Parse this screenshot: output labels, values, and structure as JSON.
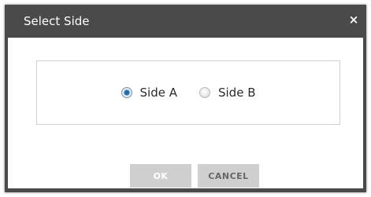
{
  "dialog": {
    "title": "Select Side",
    "close_label": "×"
  },
  "options": [
    {
      "label": "Side A",
      "checked": true
    },
    {
      "label": "Side B",
      "checked": false
    }
  ],
  "buttons": {
    "ok_label": "OK",
    "cancel_label": "CANCEL"
  },
  "colors": {
    "titlebar": "#4a4a4a",
    "button_bg": "#cfcfcf",
    "radio_selected": "#2a73b3"
  },
  "icons": {
    "close": "close-icon",
    "radio_selected": "radio-selected-icon",
    "radio_unselected": "radio-unselected-icon"
  }
}
